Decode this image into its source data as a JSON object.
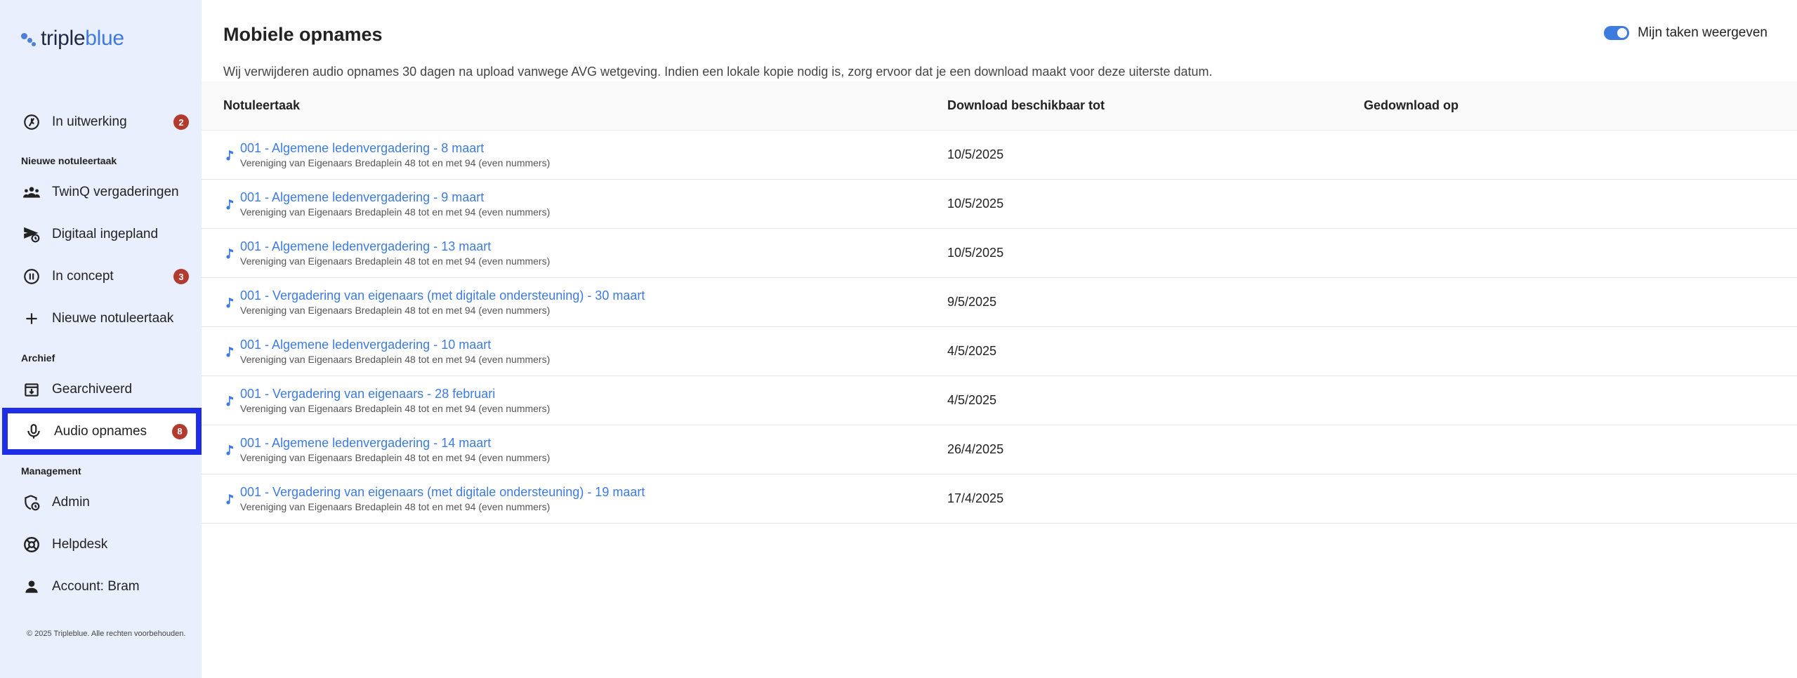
{
  "brand": {
    "part1": "triple",
    "part2": "blue"
  },
  "sidebar": {
    "in_progress": {
      "label": "In uitwerking",
      "badge": "2"
    },
    "section_new": "Nieuwe notuleertaak",
    "twinq": {
      "label": "TwinQ vergaderingen"
    },
    "digital": {
      "label": "Digitaal ingepland"
    },
    "concept": {
      "label": "In concept",
      "badge": "3"
    },
    "new_task": {
      "label": "Nieuwe notuleertaak"
    },
    "section_archive": "Archief",
    "archived": {
      "label": "Gearchiveerd"
    },
    "audio": {
      "label": "Audio opnames",
      "badge": "8"
    },
    "section_management": "Management",
    "admin": {
      "label": "Admin"
    },
    "helpdesk": {
      "label": "Helpdesk"
    },
    "account": {
      "label": "Account: Bram"
    },
    "copyright": "© 2025 Tripleblue. Alle rechten voorbehouden."
  },
  "main": {
    "title": "Mobiele opnames",
    "toggle_label": "Mijn taken weergeven",
    "notice": "Wij verwijderen audio opnames 30 dagen na upload vanwege AVG wetgeving. Indien een lokale kopie nodig is, zorg ervoor dat je een download maakt voor deze uiterste datum.",
    "columns": [
      "Notuleertaak",
      "Download beschikbaar tot",
      "Gedownload op"
    ],
    "rows": [
      {
        "title": "001 - Algemene ledenvergadering - 8 maart",
        "sub": "Vereniging van Eigenaars Bredaplein 48 tot en met 94 (even nummers)",
        "date": "10/5/2025",
        "downloaded": ""
      },
      {
        "title": "001 - Algemene ledenvergadering - 9 maart",
        "sub": "Vereniging van Eigenaars Bredaplein 48 tot en met 94 (even nummers)",
        "date": "10/5/2025",
        "downloaded": ""
      },
      {
        "title": "001 - Algemene ledenvergadering - 13 maart",
        "sub": "Vereniging van Eigenaars Bredaplein 48 tot en met 94 (even nummers)",
        "date": "10/5/2025",
        "downloaded": ""
      },
      {
        "title": "001 - Vergadering van eigenaars (met digitale ondersteuning) - 30 maart",
        "sub": "Vereniging van Eigenaars Bredaplein 48 tot en met 94 (even nummers)",
        "date": "9/5/2025",
        "downloaded": ""
      },
      {
        "title": "001 - Algemene ledenvergadering - 10 maart",
        "sub": "Vereniging van Eigenaars Bredaplein 48 tot en met 94 (even nummers)",
        "date": "4/5/2025",
        "downloaded": ""
      },
      {
        "title": "001 - Vergadering van eigenaars - 28 februari",
        "sub": "Vereniging van Eigenaars Bredaplein 48 tot en met 94 (even nummers)",
        "date": "4/5/2025",
        "downloaded": ""
      },
      {
        "title": "001 - Algemene ledenvergadering - 14 maart",
        "sub": "Vereniging van Eigenaars Bredaplein 48 tot en met 94 (even nummers)",
        "date": "26/4/2025",
        "downloaded": ""
      },
      {
        "title": "001 - Vergadering van eigenaars (met digitale ondersteuning) - 19 maart",
        "sub": "Vereniging van Eigenaars Bredaplein 48 tot en met 94 (even nummers)",
        "date": "17/4/2025",
        "downloaded": ""
      }
    ]
  },
  "colors": {
    "accent": "#3e7be0",
    "badge": "#b33a2e",
    "highlight": "#1f2ee6",
    "sidebar_bg": "#e9effc"
  }
}
